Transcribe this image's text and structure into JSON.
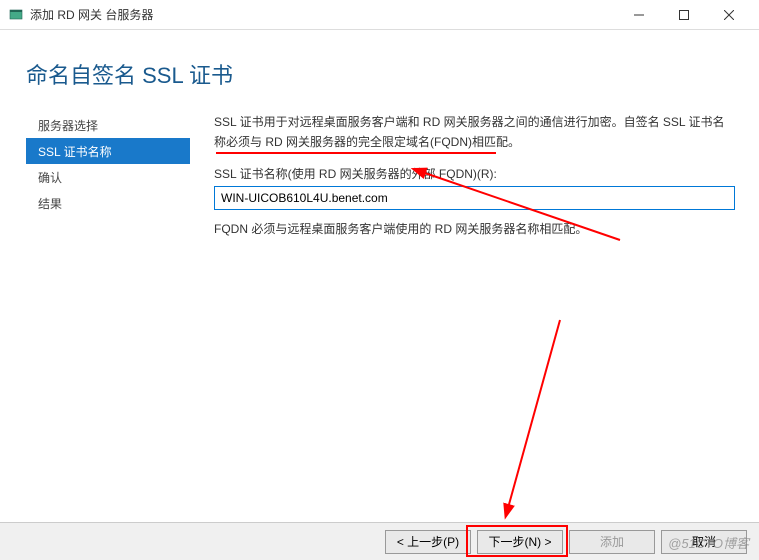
{
  "titlebar": {
    "title": "添加 RD 网关 台服务器"
  },
  "page": {
    "title": "命名自签名 SSL 证书"
  },
  "sidebar": {
    "items": [
      {
        "label": "服务器选择"
      },
      {
        "label": "SSL 证书名称"
      },
      {
        "label": "确认"
      },
      {
        "label": "结果"
      }
    ],
    "activeIndex": 1
  },
  "content": {
    "description": "SSL 证书用于对远程桌面服务客户端和 RD 网关服务器之间的通信进行加密。自签名 SSL 证书名称必须与 RD 网关服务器的完全限定域名(FQDN)相匹配。",
    "fieldLabel": "SSL 证书名称(使用 RD 网关服务器的外部 FQDN)(R):",
    "fieldValue": "WIN-UICOB610L4U.benet.com",
    "hint": "FQDN 必须与远程桌面服务客户端使用的 RD 网关服务器名称相匹配。"
  },
  "buttons": {
    "previous": "< 上一步(P)",
    "next": "下一步(N) >",
    "add": "添加",
    "cancel": "取消"
  },
  "watermark": "@51CTO博客"
}
